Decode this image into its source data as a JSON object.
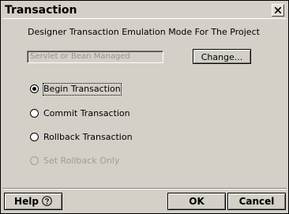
{
  "window": {
    "title": "Transaction"
  },
  "main": {
    "heading": "Designer Transaction Emulation Mode For The Project",
    "mode_field": {
      "value": "Servlet or Bean Managed"
    },
    "change_label": "Change...",
    "options": [
      {
        "label": "Begin Transaction",
        "selected": true,
        "enabled": true
      },
      {
        "label": "Commit Transaction",
        "selected": false,
        "enabled": true
      },
      {
        "label": "Rollback Transaction",
        "selected": false,
        "enabled": true
      },
      {
        "label": "Set Rollback Only",
        "selected": false,
        "enabled": false
      }
    ]
  },
  "footer": {
    "help_label": "Help",
    "ok_label": "OK",
    "cancel_label": "Cancel"
  },
  "icons": {
    "close": "close-icon",
    "help": "question-circle-icon"
  }
}
